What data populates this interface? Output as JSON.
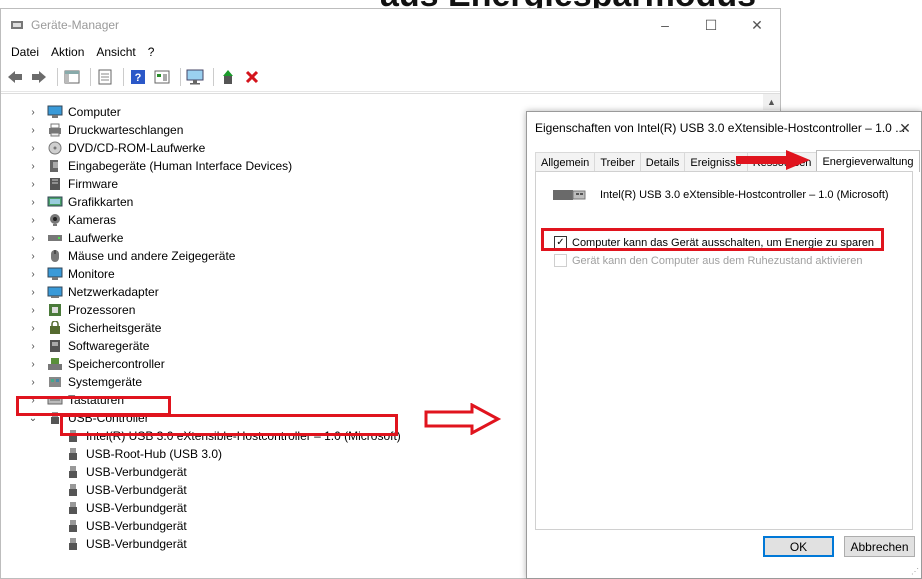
{
  "background_text": "aus Energiesparmodus",
  "devmgr": {
    "title": "Geräte-Manager",
    "window_controls": [
      "–",
      "☐",
      "✕"
    ],
    "menu": [
      "Datei",
      "Aktion",
      "Ansicht",
      "?"
    ],
    "toolbar_icons": [
      "back-icon",
      "forward-icon",
      "show-hide-tree-icon",
      "properties-icon",
      "help-icon",
      "action-view-icon",
      "monitor-icon",
      "update-driver-icon",
      "uninstall-icon"
    ],
    "tree": [
      {
        "label": "Computer",
        "icon": "computer-icon",
        "expanded": false
      },
      {
        "label": "Druckwarteschlangen",
        "icon": "printer-icon",
        "expanded": false
      },
      {
        "label": "DVD/CD-ROM-Laufwerke",
        "icon": "dvd-icon",
        "expanded": false
      },
      {
        "label": "Eingabegeräte (Human Interface Devices)",
        "icon": "hid-icon",
        "expanded": false
      },
      {
        "label": "Firmware",
        "icon": "firmware-icon",
        "expanded": false
      },
      {
        "label": "Grafikkarten",
        "icon": "display-adapter-icon",
        "expanded": false
      },
      {
        "label": "Kameras",
        "icon": "camera-icon",
        "expanded": false
      },
      {
        "label": "Laufwerke",
        "icon": "drive-icon",
        "expanded": false
      },
      {
        "label": "Mäuse und andere Zeigegeräte",
        "icon": "mouse-icon",
        "expanded": false
      },
      {
        "label": "Monitore",
        "icon": "monitor-icon",
        "expanded": false
      },
      {
        "label": "Netzwerkadapter",
        "icon": "network-icon",
        "expanded": false
      },
      {
        "label": "Prozessoren",
        "icon": "cpu-icon",
        "expanded": false
      },
      {
        "label": "Sicherheitsgeräte",
        "icon": "security-device-icon",
        "expanded": false
      },
      {
        "label": "Softwaregeräte",
        "icon": "software-device-icon",
        "expanded": false
      },
      {
        "label": "Speichercontroller",
        "icon": "storage-controller-icon",
        "expanded": false
      },
      {
        "label": "Systemgeräte",
        "icon": "system-device-icon",
        "expanded": false
      },
      {
        "label": "Tastaturen",
        "icon": "keyboard-icon",
        "expanded": false
      },
      {
        "label": "USB-Controller",
        "icon": "usb-icon",
        "expanded": true
      }
    ],
    "usb_children": [
      "Intel(R) USB 3.0 eXtensible-Hostcontroller – 1.0 (Microsoft)",
      "USB-Root-Hub (USB 3.0)",
      "USB-Verbundgerät",
      "USB-Verbundgerät",
      "USB-Verbundgerät",
      "USB-Verbundgerät",
      "USB-Verbundgerät"
    ]
  },
  "props": {
    "title": "Eigenschaften von Intel(R) USB 3.0 eXtensible-Hostcontroller – 1.0 ...",
    "close": "✕",
    "tabs": [
      "Allgemein",
      "Treiber",
      "Details",
      "Ereignisse",
      "Ressourcen",
      "Energieverwaltung"
    ],
    "active_tab": "Energieverwaltung",
    "device_name": "Intel(R) USB 3.0 eXtensible-Hostcontroller – 1.0 (Microsoft)",
    "opt_allow_off": {
      "label": "Computer kann das Gerät ausschalten, um Energie zu sparen",
      "checked": true
    },
    "opt_wake": {
      "label": "Gerät kann den Computer aus dem Ruhezustand aktivieren",
      "checked": false,
      "disabled": true
    },
    "ok": "OK",
    "cancel": "Abbrechen"
  },
  "colors": {
    "highlight": "#e0141e",
    "accent": "#0078d7"
  }
}
